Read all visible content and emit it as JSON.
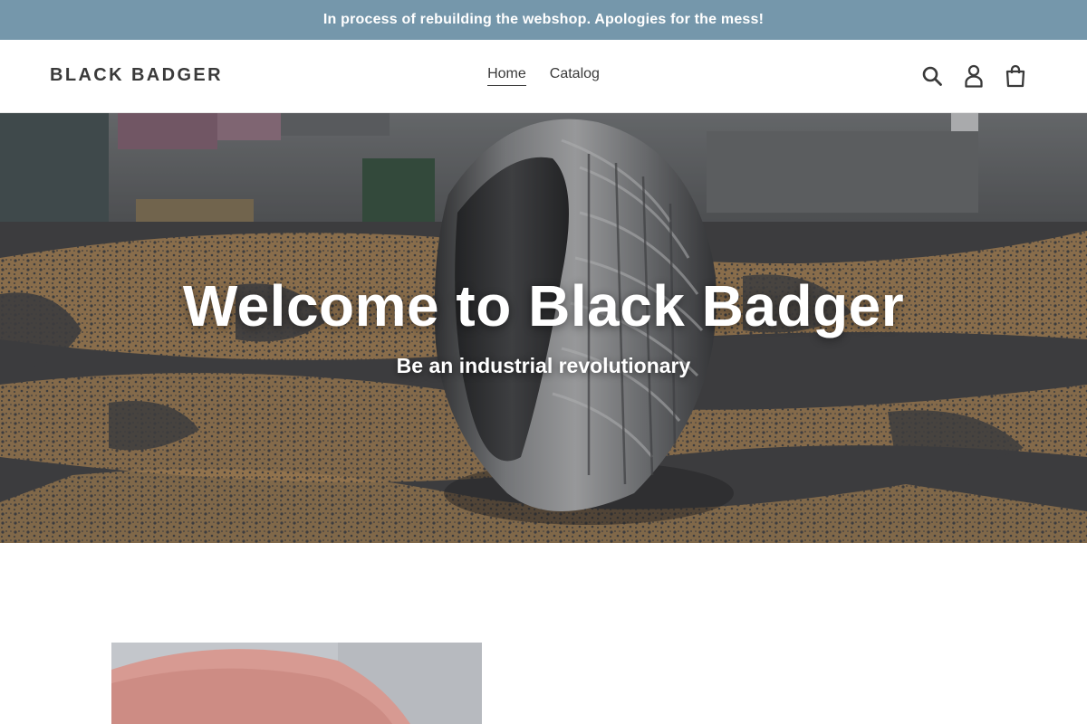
{
  "announcement": {
    "text": "In process of rebuilding the webshop. Apologies for the mess!",
    "background": "#7597ab"
  },
  "header": {
    "logo": "BLACK BADGER",
    "nav": [
      {
        "label": "Home",
        "active": true
      },
      {
        "label": "Catalog",
        "active": false
      }
    ],
    "icons": [
      "search-icon",
      "account-icon",
      "cart-icon"
    ]
  },
  "hero": {
    "title": "Welcome to Black Badger",
    "subtitle": "Be an industrial revolutionary",
    "image": "damascus-ring-photo"
  },
  "feature": {
    "image": "ring-on-finger-photo"
  }
}
